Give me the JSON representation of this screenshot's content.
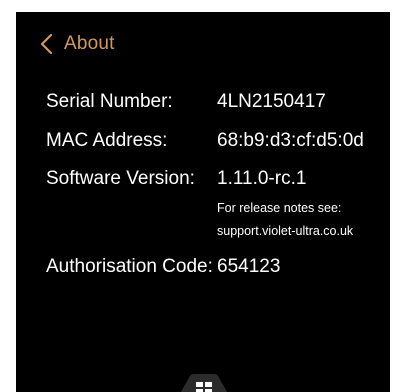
{
  "header": {
    "back_icon": "chevron-left-icon",
    "title": "About",
    "accent_color": "#d19a5a"
  },
  "info": {
    "serial_label": "Serial Number:",
    "serial_value": "4LN2150417",
    "mac_label": "MAC Address:",
    "mac_value": "68:b9:d3:cf:d5:0d",
    "software_label": "Software Version:",
    "software_value": "1.11.0-rc.1",
    "release_note_line1": "For release notes see:",
    "release_note_line2": "support.violet-ultra.co.uk",
    "auth_label": "Authorisation Code:",
    "auth_value": "654123"
  },
  "footer": {
    "menu_icon": "grid-menu-icon"
  },
  "colors": {
    "background": "#000000",
    "text": "#ffffff",
    "tab": "#2b2b2b"
  }
}
